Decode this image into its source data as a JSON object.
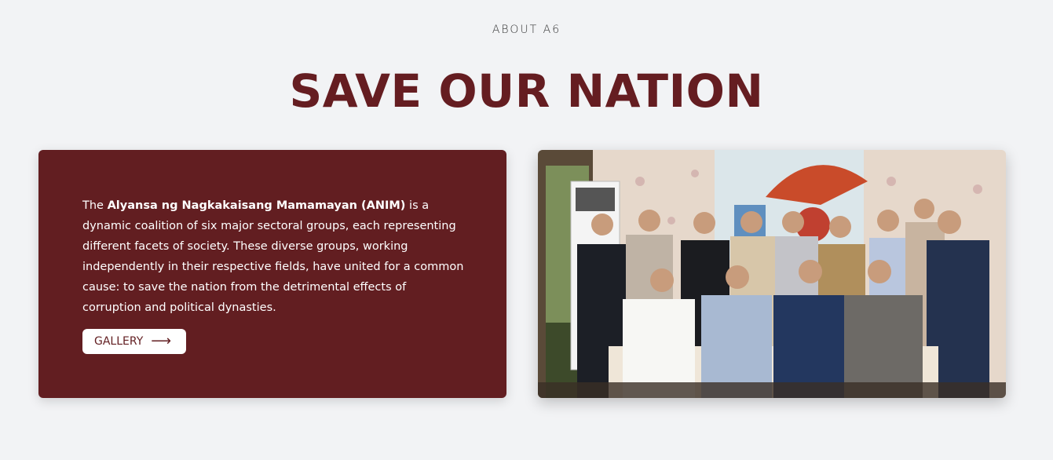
{
  "section": {
    "eyebrow": "ABOUT A6",
    "title": "SAVE OUR NATION"
  },
  "card": {
    "text_before": "The ",
    "text_bold": "Alyansa ng Nagkakaisang Mamamayan (ANIM)",
    "text_after": " is a dynamic coalition of six major sectoral groups, each representing different facets of society. These diverse groups, working independently in their respective fields, have united for a common cause: to save the nation from the detrimental effects of corruption and political dynasties.",
    "button_label": "GALLERY",
    "button_icon": "arrow-right-icon"
  },
  "colors": {
    "accent": "#621e21",
    "title": "#651d21",
    "background": "#f2f3f5"
  }
}
